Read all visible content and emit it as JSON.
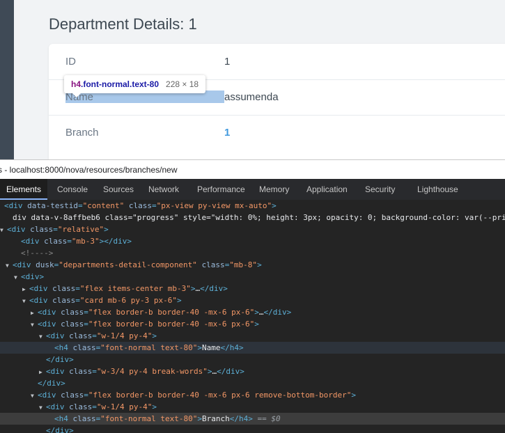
{
  "page": {
    "title": "Department Details: 1",
    "rows": [
      {
        "label": "ID",
        "value": "1"
      },
      {
        "label": "Name",
        "value": "assumenda"
      },
      {
        "label": "Branch",
        "value": "1"
      }
    ]
  },
  "tooltip": {
    "tag": "h4",
    "classes": ".font-normal.text-80",
    "size": "228 × 18"
  },
  "devtools": {
    "url": "s - localhost:8000/nova/resources/branches/new",
    "tabs": [
      "Elements",
      "Console",
      "Sources",
      "Network",
      "Performance",
      "Memory",
      "Application",
      "Security",
      "Lighthouse"
    ],
    "active_tab": "Elements",
    "dom_lines": [
      {
        "indent": 0,
        "tri": "",
        "html": "<div data-testid=\"content\" class=\"px-view py-view mx-auto\">"
      },
      {
        "indent": 1,
        "tri": "",
        "html": "<div data-v-8affbeb6 class=\"progress\" style=\"width: 0%; height: 3px; opacity: 0; background-color: var(--pri"
      },
      {
        "indent": 0,
        "tri": "▼",
        "html": "<div class=\"relative\">"
      },
      {
        "indent": 2,
        "tri": "",
        "html": "<div class=\"mb-3\"></div>"
      },
      {
        "indent": 2,
        "tri": "",
        "html": "<!---->"
      },
      {
        "indent": 1,
        "tri": "▼",
        "html": "<div dusk=\"departments-detail-component\" class=\"mb-8\">"
      },
      {
        "indent": 2,
        "tri": "▼",
        "html": "<div>"
      },
      {
        "indent": 3,
        "tri": "▶",
        "html": "<div class=\"flex items-center mb-3\">…</div>"
      },
      {
        "indent": 3,
        "tri": "▼",
        "html": "<div class=\"card mb-6 py-3 px-6\">"
      },
      {
        "indent": 4,
        "tri": "▶",
        "html": "<div class=\"flex border-b border-40 -mx-6 px-6\">…</div>"
      },
      {
        "indent": 4,
        "tri": "▼",
        "html": "<div class=\"flex border-b border-40 -mx-6 px-6\">"
      },
      {
        "indent": 5,
        "tri": "▼",
        "html": "<div class=\"w-1/4 py-4\">"
      },
      {
        "indent": 6,
        "tri": "",
        "html": "<h4 class=\"font-normal text-80\">Name</h4>"
      },
      {
        "indent": 5,
        "tri": "",
        "html": "</div>"
      },
      {
        "indent": 5,
        "tri": "▶",
        "html": "<div class=\"w-3/4 py-4 break-words\">…</div>"
      },
      {
        "indent": 4,
        "tri": "",
        "html": "</div>"
      },
      {
        "indent": 4,
        "tri": "▼",
        "html": "<div class=\"flex border-b border-40 -mx-6 px-6 remove-bottom-border\">"
      },
      {
        "indent": 5,
        "tri": "▼",
        "html": "<div class=\"w-1/4 py-4\">"
      },
      {
        "indent": 6,
        "tri": "",
        "html": "<h4 class=\"font-normal text-80\">Branch</h4>",
        "suffix": " == $0"
      },
      {
        "indent": 5,
        "tri": "",
        "html": "</div>"
      }
    ]
  }
}
